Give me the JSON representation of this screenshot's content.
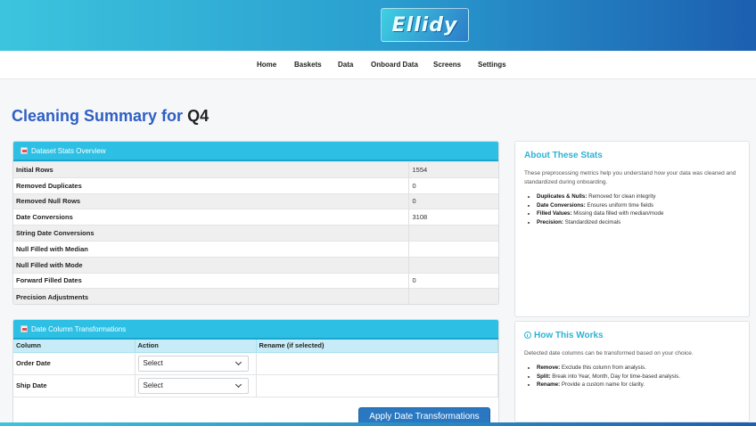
{
  "brand": {
    "logo_text": "Ellidy"
  },
  "nav": [
    "Home",
    "Baskets",
    "Data",
    "Onboard Data",
    "Screens",
    "Settings"
  ],
  "page": {
    "title_prefix": "Cleaning Summary for",
    "title_quarter": "Q4"
  },
  "stats_panel": {
    "header": "Dataset Stats Overview",
    "rows": [
      {
        "label": "Initial Rows",
        "value": "1554"
      },
      {
        "label": "Removed Duplicates",
        "value": "0"
      },
      {
        "label": "Removed Null Rows",
        "value": "0"
      },
      {
        "label": "Date Conversions",
        "value": "3108"
      },
      {
        "label": "String Date Conversions",
        "value": ""
      },
      {
        "label": "Null Filled with Median",
        "value": ""
      },
      {
        "label": "Null Filled with Mode",
        "value": ""
      },
      {
        "label": "Forward Filled Dates",
        "value": "0"
      },
      {
        "label": "Precision Adjustments",
        "value": ""
      }
    ]
  },
  "transform_panel": {
    "header": "Date Column Transformations",
    "columns": [
      "Column",
      "Action",
      "Rename (if selected)"
    ],
    "rows": [
      {
        "column": "Order Date",
        "action": "Select"
      },
      {
        "column": "Ship Date",
        "action": "Select"
      }
    ],
    "apply_label": "Apply Date Transformations"
  },
  "about_card": {
    "title": "About These Stats",
    "intro": "These preprocessing metrics help you understand how your data was cleaned and standardized during onboarding.",
    "items": [
      {
        "term": "Duplicates & Nulls:",
        "desc": "Removed for clean integrity"
      },
      {
        "term": "Date Conversions:",
        "desc": "Ensures uniform time fields"
      },
      {
        "term": "Filled Values:",
        "desc": "Missing data filled with median/mode"
      },
      {
        "term": "Precision:",
        "desc": "Standardized decimals"
      }
    ]
  },
  "how_card": {
    "title": "How This Works",
    "intro": "Detected date columns can be transformed based on your choice.",
    "items": [
      {
        "term": "Remove:",
        "desc": "Exclude this column from analysis."
      },
      {
        "term": "Split:",
        "desc": "Break into Year, Month, Day for time-based analysis."
      },
      {
        "term": "Rename:",
        "desc": "Provide a custom name for clarity."
      }
    ]
  }
}
